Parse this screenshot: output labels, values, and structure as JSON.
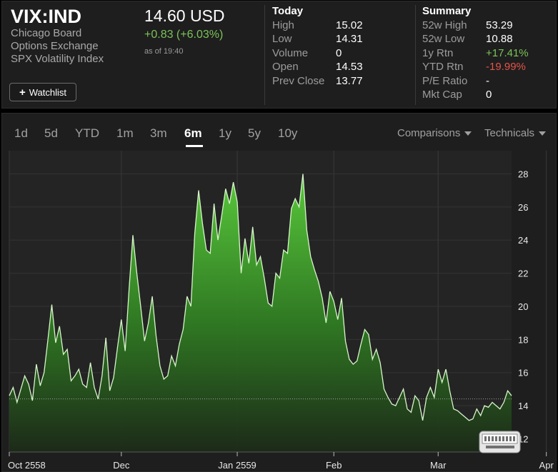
{
  "quote": {
    "symbol": "VIX:IND",
    "exchange_lines": [
      "Chicago Board",
      "Options Exchange",
      "SPX Volatility Index"
    ],
    "price": "14.60 USD",
    "change": "+0.83 (+6.03%)",
    "as_of": "as of 19:40",
    "watchlist_label": "Watchlist"
  },
  "today": {
    "title": "Today",
    "rows": [
      {
        "label": "High",
        "value": "15.02"
      },
      {
        "label": "Low",
        "value": "14.31"
      },
      {
        "label": "Volume",
        "value": "0"
      },
      {
        "label": "Open",
        "value": "14.53"
      },
      {
        "label": "Prev Close",
        "value": "13.77"
      }
    ]
  },
  "summary": {
    "title": "Summary",
    "rows": [
      {
        "label": "52w High",
        "value": "53.29",
        "tone": ""
      },
      {
        "label": "52w Low",
        "value": "10.88",
        "tone": ""
      },
      {
        "label": "1y Rtn",
        "value": "+17.41%",
        "tone": "pos"
      },
      {
        "label": "YTD Rtn",
        "value": "-19.99%",
        "tone": "neg"
      },
      {
        "label": "P/E Ratio",
        "value": "-",
        "tone": ""
      },
      {
        "label": "Mkt Cap",
        "value": "0",
        "tone": ""
      }
    ]
  },
  "ranges": [
    "1d",
    "5d",
    "YTD",
    "1m",
    "3m",
    "6m",
    "1y",
    "5y",
    "10y"
  ],
  "active_range": "6m",
  "dropdowns": {
    "comparisons": "Comparisons",
    "technicals": "Technicals"
  },
  "colors": {
    "up": "#7cc35a",
    "down": "#e5534b",
    "line": "#d6f5c8",
    "fill_top": "#5bd13c"
  },
  "icons": [
    "plus-icon",
    "caret-down-icon",
    "keyboard-icon"
  ],
  "chart_data": {
    "type": "area",
    "x_labels": [
      {
        "label": "Oct 2558",
        "index": 0
      },
      {
        "label": "Dec",
        "index": 29
      },
      {
        "label": "Jan 2559",
        "index": 59
      },
      {
        "label": "Feb",
        "index": 84
      },
      {
        "label": "Mar",
        "index": 111
      },
      {
        "label": "Apr",
        "index": 139
      }
    ],
    "y_ticks": [
      12,
      14,
      16,
      18,
      20,
      22,
      24,
      26,
      28
    ],
    "ylim": [
      11.2,
      29.4
    ],
    "reference_line": 14.41,
    "grid": true,
    "values": [
      14.6,
      15.1,
      14.2,
      15.0,
      15.8,
      15.3,
      14.3,
      16.5,
      15.2,
      16.0,
      18.0,
      20.1,
      17.8,
      18.8,
      17.1,
      17.4,
      15.5,
      15.8,
      16.2,
      15.3,
      15.1,
      16.6,
      15.1,
      14.4,
      15.8,
      18.1,
      14.9,
      15.7,
      17.5,
      19.2,
      17.3,
      21.0,
      24.3,
      22.0,
      20.0,
      17.9,
      19.0,
      20.6,
      18.2,
      16.4,
      15.6,
      15.8,
      17.0,
      16.4,
      17.7,
      18.6,
      20.6,
      20.0,
      24.4,
      27.0,
      25.0,
      23.4,
      23.2,
      26.2,
      24.0,
      25.5,
      27.1,
      26.2,
      27.5,
      26.3,
      22.0,
      24.1,
      22.6,
      24.8,
      22.5,
      23.0,
      21.7,
      20.2,
      20.0,
      22.0,
      21.7,
      23.4,
      23.2,
      25.9,
      26.5,
      26.0,
      28.0,
      24.6,
      23.0,
      22.2,
      21.5,
      20.5,
      19.0,
      20.9,
      20.3,
      19.2,
      20.5,
      17.9,
      16.8,
      16.5,
      16.7,
      17.7,
      18.6,
      18.3,
      16.8,
      17.4,
      16.6,
      15.0,
      14.5,
      14.1,
      14.0,
      14.5,
      15.0,
      13.8,
      13.6,
      14.6,
      14.3,
      13.1,
      14.5,
      15.1,
      14.5,
      16.2,
      15.4,
      16.2,
      14.9,
      13.8,
      13.7,
      13.5,
      13.3,
      13.1,
      13.2,
      13.8,
      13.4,
      14.0,
      13.9,
      14.2,
      14.0,
      13.8,
      14.2,
      14.9,
      14.6
    ]
  }
}
